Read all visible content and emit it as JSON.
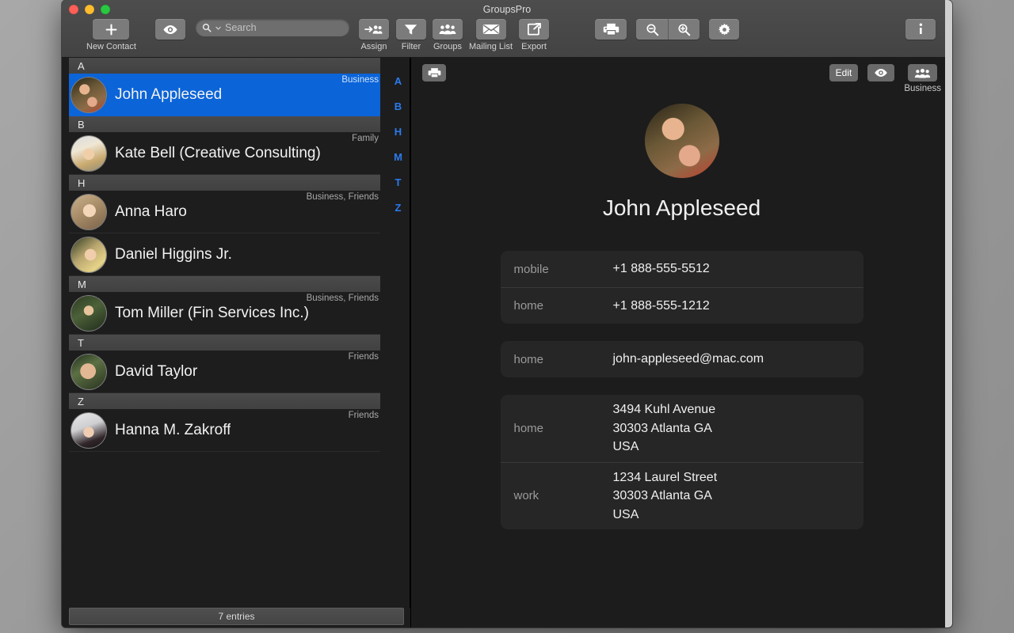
{
  "window": {
    "title": "GroupsPro",
    "traffic_lights": [
      "close",
      "minimize",
      "maximize"
    ]
  },
  "toolbar": {
    "new_contact_label": "New Contact",
    "preview_icon": "eye-icon",
    "search": {
      "placeholder": "Search",
      "value": ""
    },
    "assign_label": "Assign",
    "filter_label": "Filter",
    "groups_label": "Groups",
    "mailing_list_label": "Mailing List",
    "export_label": "Export",
    "print_icon": "printer-icon",
    "zoom_out_icon": "zoom-out-icon",
    "zoom_in_icon": "zoom-in-icon",
    "settings_icon": "gear-icon",
    "info_icon": "info-icon"
  },
  "sidebar": {
    "sections": [
      {
        "letter": "A",
        "contacts": [
          {
            "name": "John Appleseed",
            "groups": "Business",
            "selected": true,
            "avatar": "f-john"
          }
        ]
      },
      {
        "letter": "B",
        "contacts": [
          {
            "name": "Kate Bell (Creative Consulting)",
            "groups": "Family",
            "selected": false,
            "avatar": "f-kate"
          }
        ]
      },
      {
        "letter": "H",
        "contacts": [
          {
            "name": "Anna Haro",
            "groups": "Business, Friends",
            "selected": false,
            "avatar": "f-anna"
          },
          {
            "name": "Daniel Higgins Jr.",
            "groups": "",
            "selected": false,
            "avatar": "f-daniel"
          }
        ]
      },
      {
        "letter": "M",
        "contacts": [
          {
            "name": "Tom Miller (Fin Services Inc.)",
            "groups": "Business, Friends",
            "selected": false,
            "avatar": "f-tom"
          }
        ]
      },
      {
        "letter": "T",
        "contacts": [
          {
            "name": "David Taylor",
            "groups": "Friends",
            "selected": false,
            "avatar": "f-david"
          }
        ]
      },
      {
        "letter": "Z",
        "contacts": [
          {
            "name": "Hanna M. Zakroff",
            "groups": "Friends",
            "selected": false,
            "avatar": "f-hanna"
          }
        ]
      }
    ],
    "index_letters": [
      "A",
      "B",
      "H",
      "M",
      "T",
      "Z"
    ],
    "status": "7 entries"
  },
  "detail": {
    "print_icon": "printer-icon",
    "edit_label": "Edit",
    "preview_icon": "eye-icon",
    "groups_icon": "groups-icon",
    "group_label": "Business",
    "contact_name": "John Appleseed",
    "avatar": "f-john",
    "cards": [
      {
        "fields": [
          {
            "label": "mobile",
            "value": "+1 888-555-5512"
          },
          {
            "label": "home",
            "value": "+1 888-555-1212"
          }
        ]
      },
      {
        "fields": [
          {
            "label": "home",
            "value": "john-appleseed@mac.com"
          }
        ]
      },
      {
        "fields": [
          {
            "label": "home",
            "value": "3494 Kuhl Avenue\n30303 Atlanta GA\nUSA"
          },
          {
            "label": "work",
            "value": "1234 Laurel Street\n30303 Atlanta GA\nUSA"
          }
        ]
      }
    ]
  },
  "colors": {
    "selection_blue": "#0b64d8",
    "index_blue": "#2a7bef",
    "window_bg": "#1c1c1c",
    "card_bg": "#262626",
    "toolbar_bg": "#474747"
  }
}
